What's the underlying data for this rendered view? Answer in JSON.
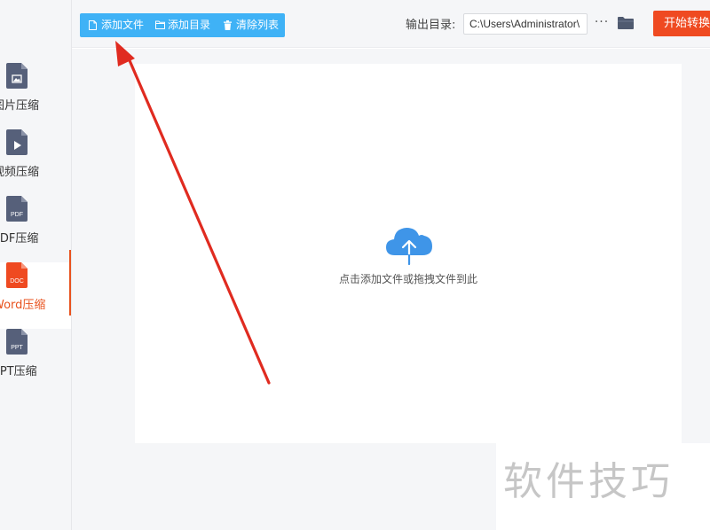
{
  "sidebar": {
    "items": [
      {
        "label": "图片压缩",
        "icon": "image-file-icon",
        "badge": "",
        "active": false
      },
      {
        "label": "视频压缩",
        "icon": "video-file-icon",
        "badge": "",
        "active": false
      },
      {
        "label": "PDF压缩",
        "icon": "pdf-file-icon",
        "badge": "PDF",
        "active": false
      },
      {
        "label": "Word压缩",
        "icon": "doc-file-icon",
        "badge": "DOC",
        "active": true
      },
      {
        "label": "PPT压缩",
        "icon": "ppt-file-icon",
        "badge": "PPT",
        "active": false
      }
    ]
  },
  "toolbar": {
    "add_file": "添加文件",
    "add_dir": "添加目录",
    "clear_list": "清除列表",
    "output_label": "输出目录:",
    "output_path": "C:\\Users\\Administrator\\",
    "more": "···",
    "start": "开始转换"
  },
  "main": {
    "drop_hint": "点击添加文件或拖拽文件到此"
  },
  "watermark": "软件技巧",
  "colors": {
    "accent_blue": "#3fb2f6",
    "accent_orange": "#ef4a21",
    "active_orange": "#e8521e",
    "icon_gray": "#56607a",
    "annotation_red": "#e02b20"
  }
}
